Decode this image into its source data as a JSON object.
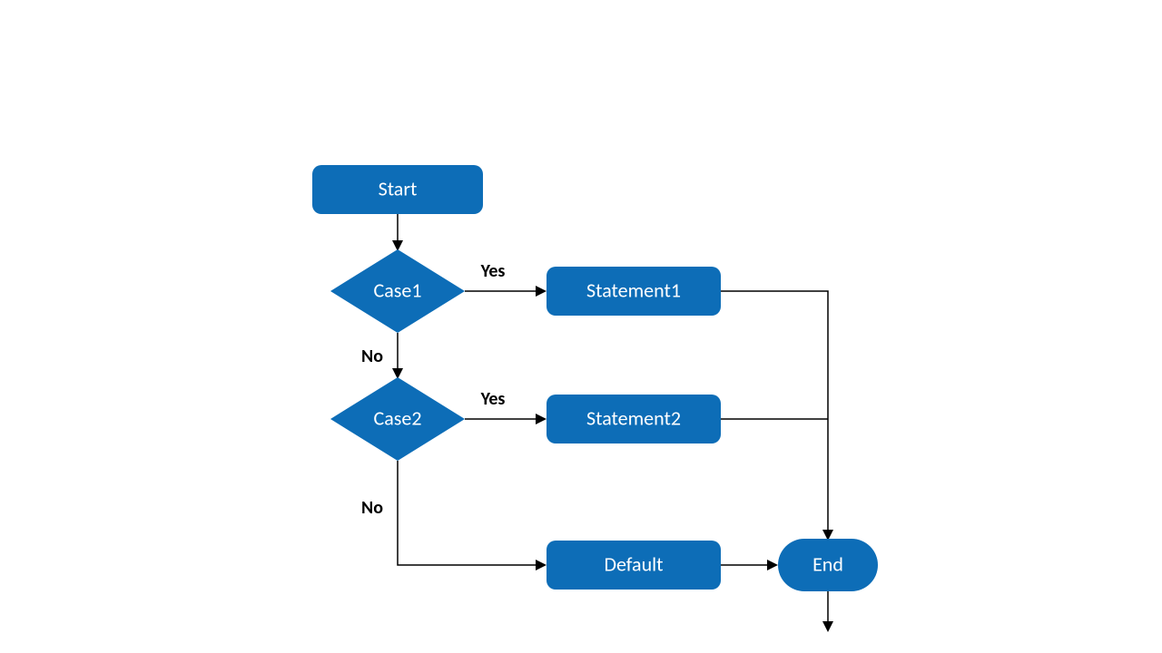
{
  "colors": {
    "shape_fill": "#0d6db7",
    "shape_text": "#ffffff",
    "edge": "#000000"
  },
  "nodes": {
    "start": {
      "label": "Start",
      "shape": "rounded-rect"
    },
    "case1": {
      "label": "Case1",
      "shape": "diamond"
    },
    "case2": {
      "label": "Case2",
      "shape": "diamond"
    },
    "statement1": {
      "label": "Statement1",
      "shape": "rounded-rect"
    },
    "statement2": {
      "label": "Statement2",
      "shape": "rounded-rect"
    },
    "default": {
      "label": "Default",
      "shape": "rounded-rect"
    },
    "end": {
      "label": "End",
      "shape": "pill"
    }
  },
  "edge_labels": {
    "case1_yes": "Yes",
    "case1_no": "No",
    "case2_yes": "Yes",
    "case2_no": "No"
  },
  "edges": [
    {
      "from": "start",
      "to": "case1"
    },
    {
      "from": "case1",
      "to": "statement1",
      "label_key": "case1_yes"
    },
    {
      "from": "case1",
      "to": "case2",
      "label_key": "case1_no"
    },
    {
      "from": "case2",
      "to": "statement2",
      "label_key": "case2_yes"
    },
    {
      "from": "case2",
      "to": "default",
      "label_key": "case2_no"
    },
    {
      "from": "statement1",
      "to": "end"
    },
    {
      "from": "statement2",
      "to": "end"
    },
    {
      "from": "default",
      "to": "end"
    },
    {
      "from": "end",
      "to": "(exit)"
    }
  ]
}
